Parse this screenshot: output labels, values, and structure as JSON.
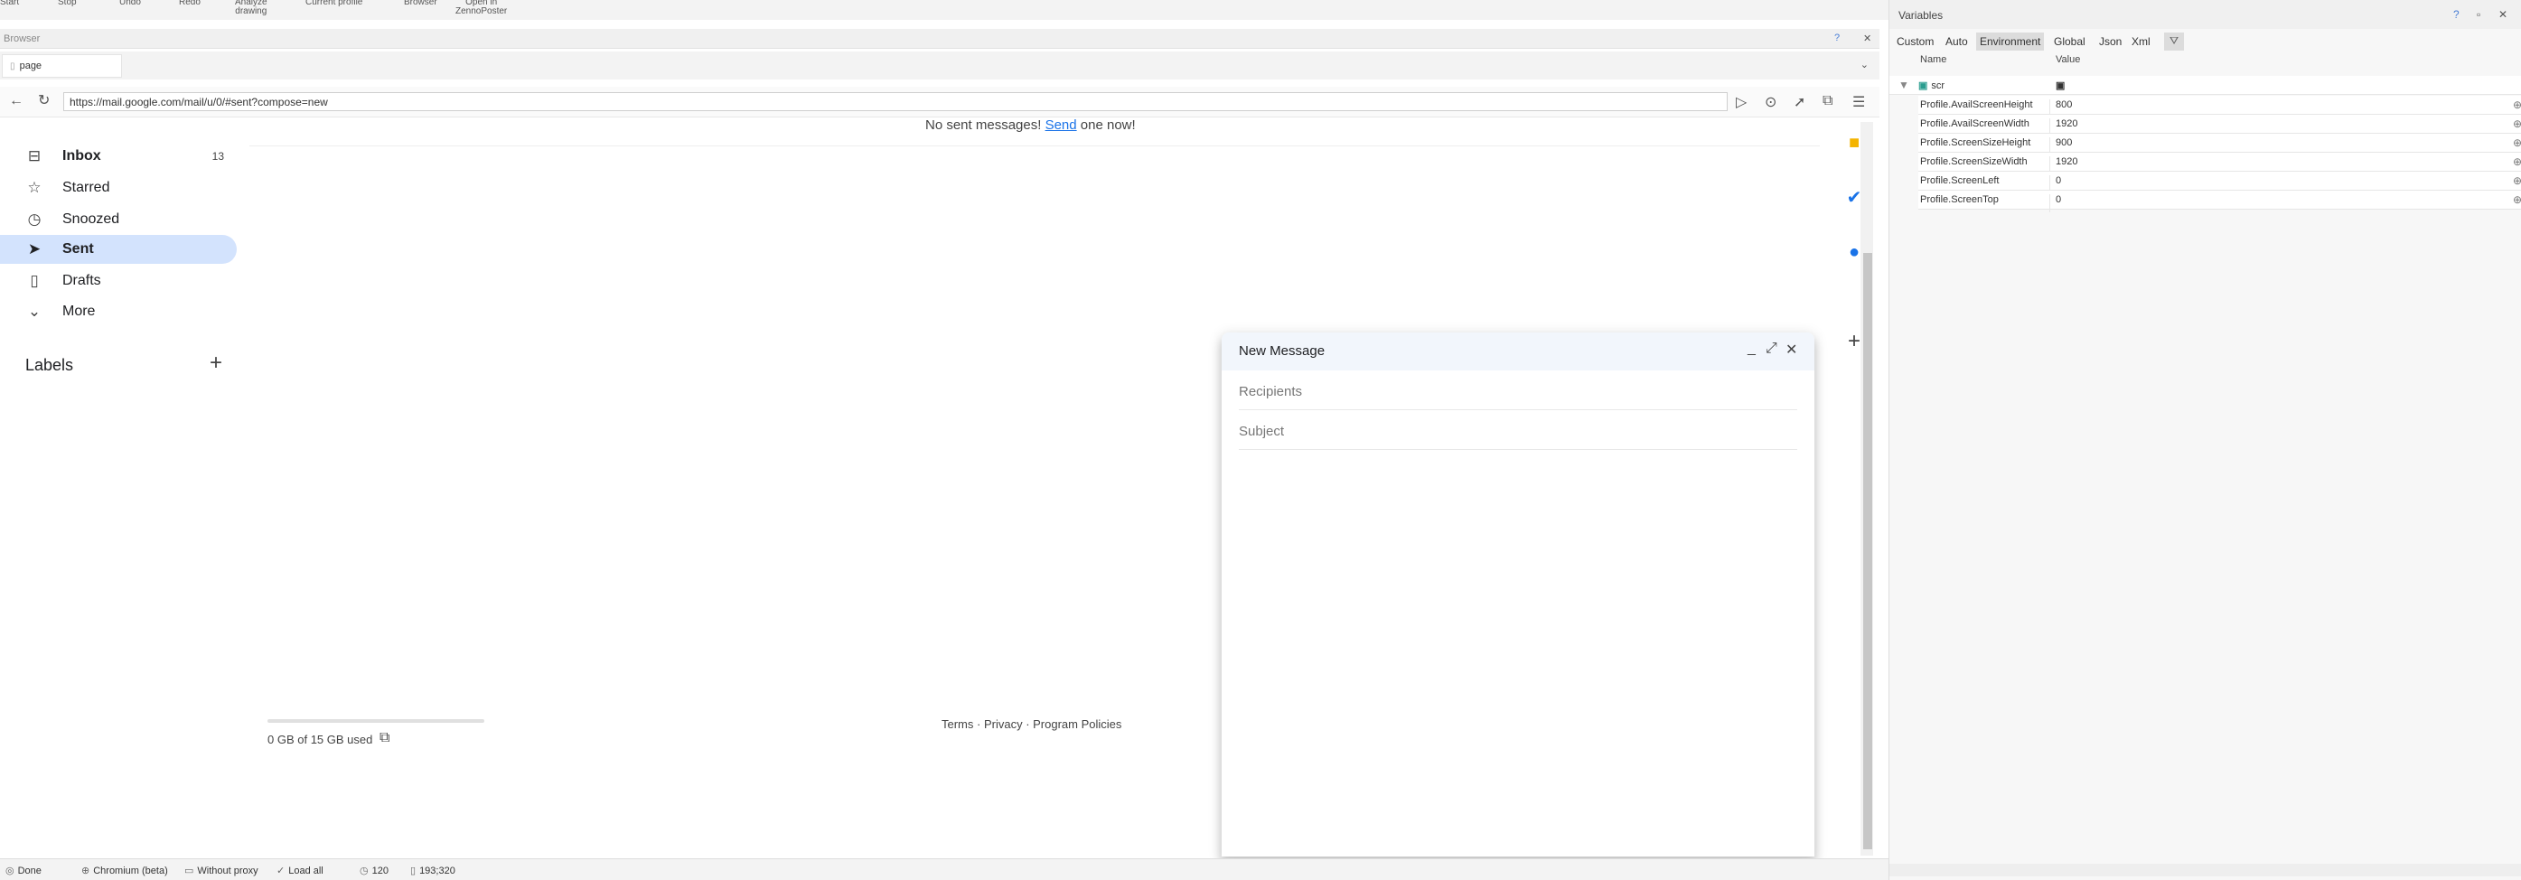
{
  "top_toolbar": {
    "items": [
      "Start",
      "Stop",
      "Undo",
      "Redo",
      "Analyze\ndrawing",
      "Current profile",
      "Browser",
      "Open in\nZennoPoster"
    ]
  },
  "browser": {
    "panel_title": "Browser",
    "help": "?",
    "pin": "⊞",
    "tab_label": "page",
    "url": "https://mail.google.com/mail/u/0/#sent?compose=new"
  },
  "gmail": {
    "nav": [
      {
        "label": "Inbox",
        "count": "13",
        "icon": "inbox-icon"
      },
      {
        "label": "Starred",
        "count": "",
        "icon": "star-icon"
      },
      {
        "label": "Snoozed",
        "count": "",
        "icon": "clock-icon"
      },
      {
        "label": "Sent",
        "count": "",
        "icon": "send-icon"
      },
      {
        "label": "Drafts",
        "count": "",
        "icon": "draft-icon"
      },
      {
        "label": "More",
        "count": "",
        "icon": "chevron-down-icon"
      }
    ],
    "labels_title": "Labels",
    "empty_prefix": "No sent messages! ",
    "empty_link": "Send",
    "empty_suffix": " one now!",
    "storage_text": "0 GB of 15 GB used",
    "storage_fraction": 0.0,
    "footer": {
      "terms": "Terms",
      "privacy": "Privacy",
      "policies": "Program Policies",
      "sep": " · "
    }
  },
  "compose": {
    "title": "New Message",
    "recipients_placeholder": "Recipients",
    "subject_placeholder": "Subject"
  },
  "status_bar": {
    "done": "Done",
    "browser": "Chromium (beta)",
    "proxy": "Without proxy",
    "load": "Load all",
    "timeout": "120",
    "coords": "193;320"
  },
  "variables": {
    "title": "Variables",
    "tabs": [
      "Custom",
      "Auto",
      "Environment",
      "Global",
      "Json",
      "Xml"
    ],
    "active_tab": "Environment",
    "col_name": "Name",
    "col_value": "Value",
    "filter_text": "scr",
    "rows": [
      {
        "name": "Profile.AvailScreenHeight",
        "value": "800"
      },
      {
        "name": "Profile.AvailScreenWidth",
        "value": "1920"
      },
      {
        "name": "Profile.ScreenSizeHeight",
        "value": "900"
      },
      {
        "name": "Profile.ScreenSizeWidth",
        "value": "1920"
      },
      {
        "name": "Profile.ScreenLeft",
        "value": "0"
      },
      {
        "name": "Profile.ScreenTop",
        "value": "0"
      }
    ]
  },
  "colors": {
    "accent": "#1a73e8",
    "active_nav": "#d3e3fd"
  }
}
